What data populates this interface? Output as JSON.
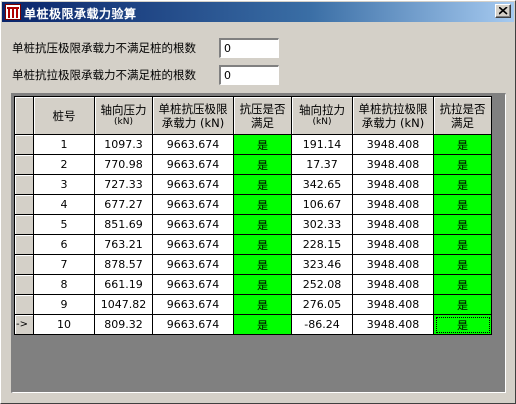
{
  "window": {
    "title": "单桩极限承载力验算",
    "icon": "app-logo-icon",
    "close_label": "close-icon"
  },
  "summary": {
    "compression_label": "单桩抗压极限承载力不满足桩的根数",
    "compression_value": "0",
    "tension_label": "单桩抗拉极限承载力不满足桩的根数",
    "tension_value": "0"
  },
  "table": {
    "headers": {
      "pile_no": "桩号",
      "axial_pressure": "轴向压力",
      "axial_pressure_unit": "(kN)",
      "comp_capacity": "单桩抗压极限",
      "comp_capacity_2": "承载力 (kN)",
      "comp_ok": "抗压是否",
      "comp_ok_2": "满足",
      "axial_tension": "轴向拉力",
      "axial_tension_unit": "(kN)",
      "tens_capacity": "单桩抗拉极限",
      "tens_capacity_2": "承载力 (kN)",
      "tens_ok": "抗拉是否",
      "tens_ok_2": "满足"
    },
    "current_row_marker": "->",
    "rows": [
      {
        "no": "1",
        "pressure": "1097.3",
        "comp_cap": "9663.674",
        "comp_ok": "是",
        "tension": "191.14",
        "tens_cap": "3948.408",
        "tens_ok": "是"
      },
      {
        "no": "2",
        "pressure": "770.98",
        "comp_cap": "9663.674",
        "comp_ok": "是",
        "tension": "17.37",
        "tens_cap": "3948.408",
        "tens_ok": "是"
      },
      {
        "no": "3",
        "pressure": "727.33",
        "comp_cap": "9663.674",
        "comp_ok": "是",
        "tension": "342.65",
        "tens_cap": "3948.408",
        "tens_ok": "是"
      },
      {
        "no": "4",
        "pressure": "677.27",
        "comp_cap": "9663.674",
        "comp_ok": "是",
        "tension": "106.67",
        "tens_cap": "3948.408",
        "tens_ok": "是"
      },
      {
        "no": "5",
        "pressure": "851.69",
        "comp_cap": "9663.674",
        "comp_ok": "是",
        "tension": "302.33",
        "tens_cap": "3948.408",
        "tens_ok": "是"
      },
      {
        "no": "6",
        "pressure": "763.21",
        "comp_cap": "9663.674",
        "comp_ok": "是",
        "tension": "228.15",
        "tens_cap": "3948.408",
        "tens_ok": "是"
      },
      {
        "no": "7",
        "pressure": "878.57",
        "comp_cap": "9663.674",
        "comp_ok": "是",
        "tension": "323.46",
        "tens_cap": "3948.408",
        "tens_ok": "是"
      },
      {
        "no": "8",
        "pressure": "661.19",
        "comp_cap": "9663.674",
        "comp_ok": "是",
        "tension": "252.08",
        "tens_cap": "3948.408",
        "tens_ok": "是"
      },
      {
        "no": "9",
        "pressure": "1047.82",
        "comp_cap": "9663.674",
        "comp_ok": "是",
        "tension": "276.05",
        "tens_cap": "3948.408",
        "tens_ok": "是"
      },
      {
        "no": "10",
        "pressure": "809.32",
        "comp_cap": "9663.674",
        "comp_ok": "是",
        "tension": "-86.24",
        "tens_cap": "3948.408",
        "tens_ok": "是"
      }
    ]
  },
  "colors": {
    "title_gradient_start": "#0a246a",
    "title_gradient_end": "#a6caf0",
    "ok_cell": "#00ff00",
    "face": "#d4d0c8",
    "grid_background": "#808080"
  }
}
